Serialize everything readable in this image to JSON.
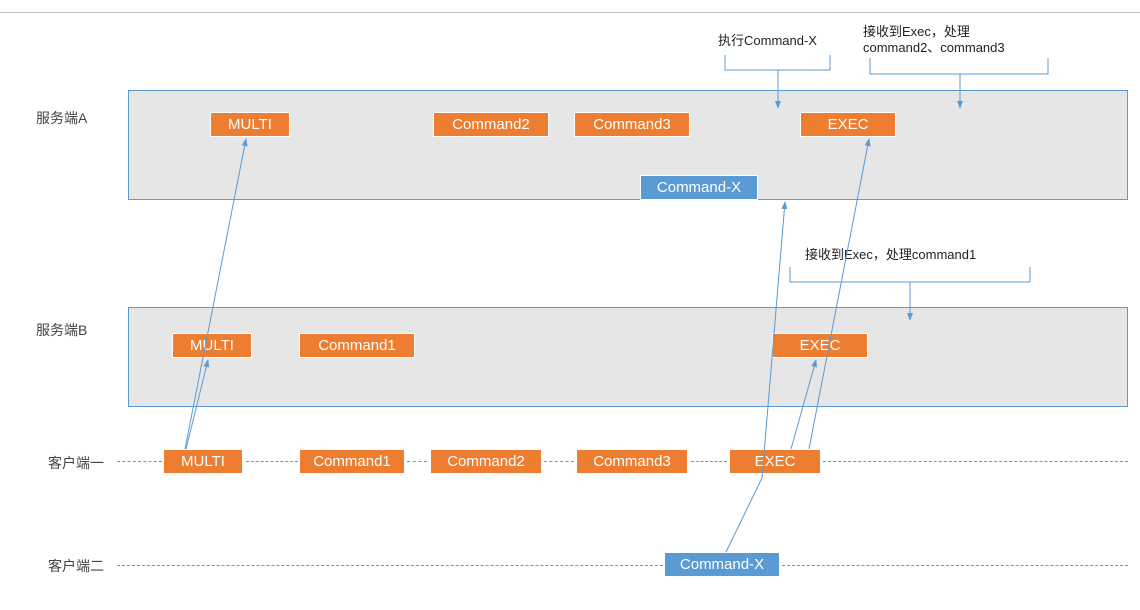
{
  "labels": {
    "serverA": "服务端A",
    "serverB": "服务端B",
    "client1": "客户端一",
    "client2": "客户端二"
  },
  "serverA": {
    "multi": "MULTI",
    "command2": "Command2",
    "command3": "Command3",
    "exec": "EXEC",
    "commandX": "Command-X"
  },
  "serverB": {
    "multi": "MULTI",
    "command1": "Command1",
    "exec": "EXEC"
  },
  "client1": {
    "multi": "MULTI",
    "command1": "Command1",
    "command2": "Command2",
    "command3": "Command3",
    "exec": "EXEC"
  },
  "client2": {
    "commandX": "Command-X"
  },
  "annotations": {
    "execCmdX": "执行Command-X",
    "recvExec23": "接收到Exec，处理\ncommand2、command3",
    "recvExec1": "接收到Exec，处理command1"
  }
}
